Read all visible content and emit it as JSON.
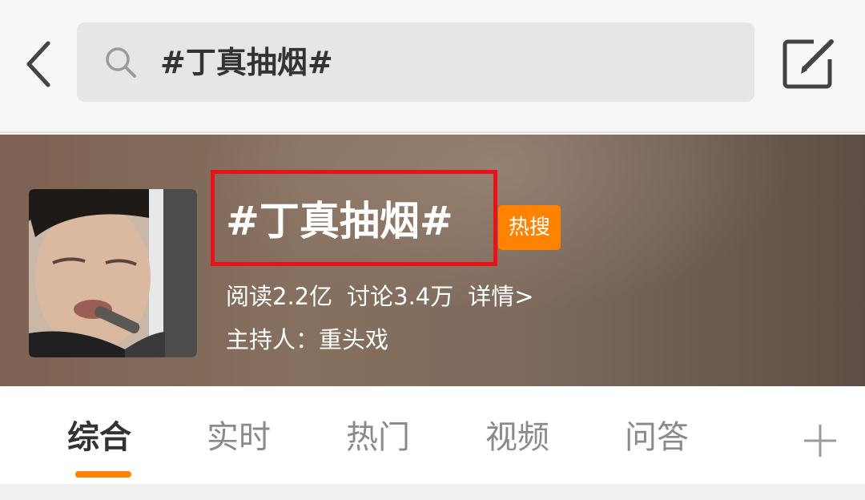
{
  "search": {
    "query": "#丁真抽烟#",
    "icons": {
      "back": "back-arrow-icon",
      "search": "search-icon",
      "compose": "compose-edit-icon"
    }
  },
  "topic": {
    "title": "#丁真抽烟#",
    "badge": "热搜",
    "reads": "阅读2.2亿",
    "discussions": "讨论3.4万",
    "detail_link": "详情>",
    "host": "主持人：重头戏",
    "highlight_color": "#e8121b",
    "badge_color": "#ff8200"
  },
  "tabs": {
    "items": [
      {
        "label": "综合",
        "active": true
      },
      {
        "label": "实时",
        "active": false
      },
      {
        "label": "热门",
        "active": false
      },
      {
        "label": "视频",
        "active": false
      },
      {
        "label": "问答",
        "active": false
      }
    ],
    "add_icon": "plus-icon",
    "accent_color": "#ff8200"
  }
}
